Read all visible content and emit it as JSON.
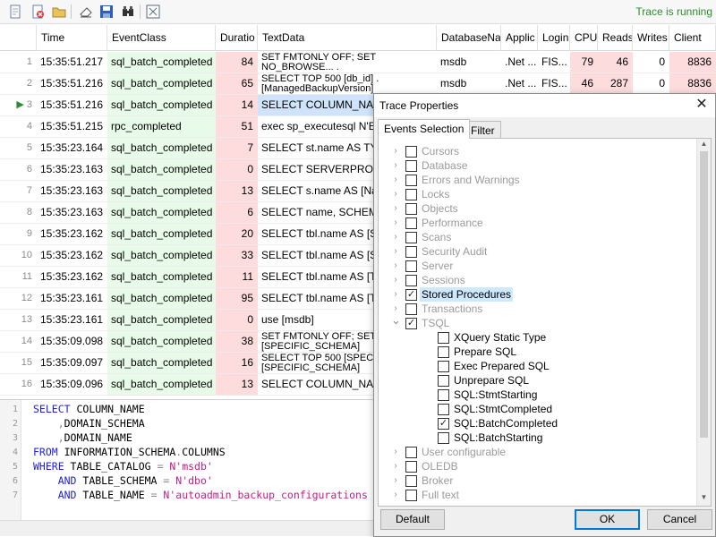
{
  "toolbar": {
    "status": "Trace is running",
    "icons": [
      "new-trace-icon",
      "clear-trace-icon",
      "open-folder-icon",
      "eraser-icon",
      "save-icon",
      "find-icon",
      "properties-icon"
    ]
  },
  "grid": {
    "columns": [
      "Time",
      "EventClass",
      "Duratio",
      "TextData",
      "DatabaseNa",
      "Applic",
      "Login",
      "CPU",
      "Reads",
      "Writes",
      "Client"
    ],
    "rows": [
      {
        "n": "1",
        "time": "15:35:51.217",
        "ev": "sql_batch_completed",
        "dur": "84",
        "text": "SET FMTONLY OFF; SET NO_BROWSE... .[ManagedBackupVersion]",
        "db": "msdb",
        "app": ".Net ...",
        "login": "FIS...",
        "cpu": "79",
        "reads": "46",
        "writes": "0",
        "client": "8836"
      },
      {
        "n": "2",
        "time": "15:35:51.216",
        "ev": "sql_batch_completed",
        "dur": "65",
        "text": "SELECT TOP 500 [db_id] .[ManagedBackupVersion]",
        "db": "msdb",
        "app": ".Net ...",
        "login": "FIS...",
        "cpu": "46",
        "reads": "287",
        "writes": "0",
        "client": "8836"
      },
      {
        "n": "3",
        "time": "15:35:51.216",
        "ev": "sql_batch_completed",
        "dur": "14",
        "text": "SELECT COLUMN_NAME,",
        "selected": true
      },
      {
        "n": "4",
        "time": "15:35:51.215",
        "ev": "rpc_completed",
        "dur": "51",
        "text": "exec sp_executesql N'EXEC"
      },
      {
        "n": "5",
        "time": "15:35:23.164",
        "ev": "sql_batch_completed",
        "dur": "7",
        "text": "SELECT st.name AS TYPEN"
      },
      {
        "n": "6",
        "time": "15:35:23.163",
        "ev": "sql_batch_completed",
        "dur": "0",
        "text": "SELECT SERVERPROPERTY"
      },
      {
        "n": "7",
        "time": "15:35:23.163",
        "ev": "sql_batch_completed",
        "dur": "13",
        "text": "SELECT s.name AS [Name"
      },
      {
        "n": "8",
        "time": "15:35:23.163",
        "ev": "sql_batch_completed",
        "dur": "6",
        "text": "SELECT name, SCHEMA_N"
      },
      {
        "n": "9",
        "time": "15:35:23.162",
        "ev": "sql_batch_completed",
        "dur": "20",
        "text": "SELECT tbl.name AS [SPEC"
      },
      {
        "n": "10",
        "time": "15:35:23.162",
        "ev": "sql_batch_completed",
        "dur": "33",
        "text": "SELECT tbl.name AS [SPEC"
      },
      {
        "n": "11",
        "time": "15:35:23.162",
        "ev": "sql_batch_completed",
        "dur": "11",
        "text": "SELECT tbl.name AS [TABL"
      },
      {
        "n": "12",
        "time": "15:35:23.161",
        "ev": "sql_batch_completed",
        "dur": "95",
        "text": "SELECT tbl.name AS [TABL"
      },
      {
        "n": "13",
        "time": "15:35:23.161",
        "ev": "sql_batch_completed",
        "dur": "0",
        "text": "use [msdb]"
      },
      {
        "n": "14",
        "time": "15:35:09.098",
        "ev": "sql_batch_completed",
        "dur": "38",
        "text": "SET FMTONLY OFF; SET N .[SPECIFIC_SCHEMA]"
      },
      {
        "n": "15",
        "time": "15:35:09.097",
        "ev": "sql_batch_completed",
        "dur": "16",
        "text": "SELECT TOP 500 [SPECIFIC .[SPECIFIC_SCHEMA]"
      },
      {
        "n": "16",
        "time": "15:35:09.096",
        "ev": "sql_batch_completed",
        "dur": "13",
        "text": "SELECT COLUMN_NAME,"
      }
    ]
  },
  "editor": {
    "line_numbers": [
      "1",
      "2",
      "3",
      "4",
      "5",
      "6",
      "7"
    ],
    "lines": [
      [
        {
          "t": "SELECT",
          "c": "kw"
        },
        {
          "t": " COLUMN_NAME",
          "c": ""
        }
      ],
      [
        {
          "t": "    ,",
          "c": "op"
        },
        {
          "t": "DOMAIN_SCHEMA",
          "c": ""
        }
      ],
      [
        {
          "t": "    ,",
          "c": "op"
        },
        {
          "t": "DOMAIN_NAME",
          "c": ""
        }
      ],
      [
        {
          "t": "FROM",
          "c": "kw"
        },
        {
          "t": " INFORMATION_SCHEMA",
          "c": ""
        },
        {
          "t": ".",
          "c": "op"
        },
        {
          "t": "COLUMNS",
          "c": ""
        }
      ],
      [
        {
          "t": "WHERE",
          "c": "kw"
        },
        {
          "t": " TABLE_CATALOG ",
          "c": ""
        },
        {
          "t": "=",
          "c": "op"
        },
        {
          "t": " N'msdb'",
          "c": "str"
        }
      ],
      [
        {
          "t": "    AND",
          "c": "kw"
        },
        {
          "t": " TABLE_SCHEMA ",
          "c": ""
        },
        {
          "t": "=",
          "c": "op"
        },
        {
          "t": " N'dbo'",
          "c": "str"
        }
      ],
      [
        {
          "t": "    AND",
          "c": "kw"
        },
        {
          "t": " TABLE_NAME ",
          "c": ""
        },
        {
          "t": "=",
          "c": "op"
        },
        {
          "t": " N'autoadmin_backup_configurations",
          "c": "str"
        }
      ]
    ]
  },
  "dialog": {
    "title": "Trace Properties",
    "tabs": [
      "Events Selection",
      "Filter"
    ],
    "tree": [
      {
        "label": "Cursors",
        "level": 0,
        "expanded": false,
        "checked": false,
        "dim": true
      },
      {
        "label": "Database",
        "level": 0,
        "expanded": false,
        "checked": false,
        "dim": true
      },
      {
        "label": "Errors and Warnings",
        "level": 0,
        "expanded": false,
        "checked": false,
        "dim": true
      },
      {
        "label": "Locks",
        "level": 0,
        "expanded": false,
        "checked": false,
        "dim": true
      },
      {
        "label": "Objects",
        "level": 0,
        "expanded": false,
        "checked": false,
        "dim": true
      },
      {
        "label": "Performance",
        "level": 0,
        "expanded": false,
        "checked": false,
        "dim": true
      },
      {
        "label": "Scans",
        "level": 0,
        "expanded": false,
        "checked": false,
        "dim": true
      },
      {
        "label": "Security Audit",
        "level": 0,
        "expanded": false,
        "checked": false,
        "dim": true
      },
      {
        "label": "Server",
        "level": 0,
        "expanded": false,
        "checked": false,
        "dim": true
      },
      {
        "label": "Sessions",
        "level": 0,
        "expanded": false,
        "checked": false,
        "dim": true
      },
      {
        "label": "Stored Procedures",
        "level": 0,
        "expanded": false,
        "checked": true,
        "dim": false,
        "highlight": true
      },
      {
        "label": "Transactions",
        "level": 0,
        "expanded": false,
        "checked": false,
        "dim": true
      },
      {
        "label": "TSQL",
        "level": 0,
        "expanded": true,
        "checked": true,
        "dim": true
      },
      {
        "label": "XQuery Static Type",
        "level": 1,
        "checked": false,
        "dim": false
      },
      {
        "label": "Prepare SQL",
        "level": 1,
        "checked": false,
        "dim": false
      },
      {
        "label": "Exec Prepared SQL",
        "level": 1,
        "checked": false,
        "dim": false
      },
      {
        "label": "Unprepare SQL",
        "level": 1,
        "checked": false,
        "dim": false
      },
      {
        "label": "SQL:StmtStarting",
        "level": 1,
        "checked": false,
        "dim": false
      },
      {
        "label": "SQL:StmtCompleted",
        "level": 1,
        "checked": false,
        "dim": false
      },
      {
        "label": "SQL:BatchCompleted",
        "level": 1,
        "checked": true,
        "dim": false
      },
      {
        "label": "SQL:BatchStarting",
        "level": 1,
        "checked": false,
        "dim": false
      },
      {
        "label": "User configurable",
        "level": 0,
        "expanded": false,
        "checked": false,
        "dim": true
      },
      {
        "label": "OLEDB",
        "level": 0,
        "expanded": false,
        "checked": false,
        "dim": true
      },
      {
        "label": "Broker",
        "level": 0,
        "expanded": false,
        "checked": false,
        "dim": true
      },
      {
        "label": "Full text",
        "level": 0,
        "expanded": false,
        "checked": false,
        "dim": true
      }
    ],
    "buttons": {
      "default": "Default",
      "ok": "OK",
      "cancel": "Cancel"
    }
  }
}
